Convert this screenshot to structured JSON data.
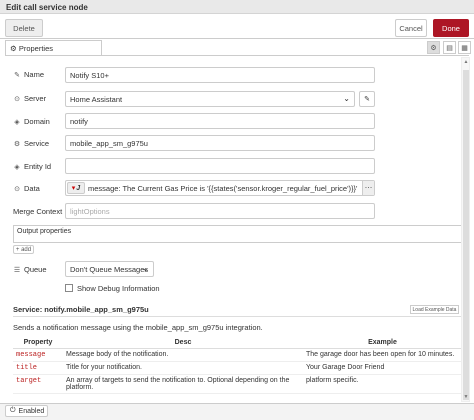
{
  "window": {
    "title": "Edit call service node"
  },
  "toolbar": {
    "delete_label": "Delete",
    "cancel_label": "Cancel",
    "done_label": "Done"
  },
  "tabs": {
    "properties_label": "Properties"
  },
  "form": {
    "name_label": "Name",
    "name_value": "Notify S10+",
    "server_label": "Server",
    "server_value": "Home Assistant",
    "domain_label": "Domain",
    "domain_value": "notify",
    "service_label": "Service",
    "service_value": "mobile_app_sm_g975u",
    "entity_label": "Entity Id",
    "entity_value": "",
    "data_label": "Data",
    "data_value": "message: The Current Gas Price is '{{states('sensor.kroger_regular_fuel_price')}}'",
    "merge_label": "Merge Context",
    "merge_placeholder": "lightOptions",
    "output_label": "Output properties",
    "add_label": "add",
    "queue_label": "Queue",
    "queue_value": "Don't Queue Messages",
    "debug_label": "Show Debug Information"
  },
  "service_info": {
    "title": "Service: notify.mobile_app_sm_g975u",
    "load_label": "Load Example Data",
    "description": "Sends a notification message using the mobile_app_sm_g975u integration.",
    "columns": [
      "Property",
      "Desc",
      "Example"
    ],
    "rows": [
      {
        "prop": "message",
        "desc": "Message body of the notification.",
        "example": "The garage door has been open for 10 minutes."
      },
      {
        "prop": "title",
        "desc": "Title for your notification.",
        "example": "Your Garage Door Friend"
      },
      {
        "prop": "target",
        "desc": "An array of targets to send the notification to. Optional depending on the platform.",
        "example": "platform specific."
      }
    ]
  },
  "footer": {
    "enabled_label": "Enabled"
  }
}
